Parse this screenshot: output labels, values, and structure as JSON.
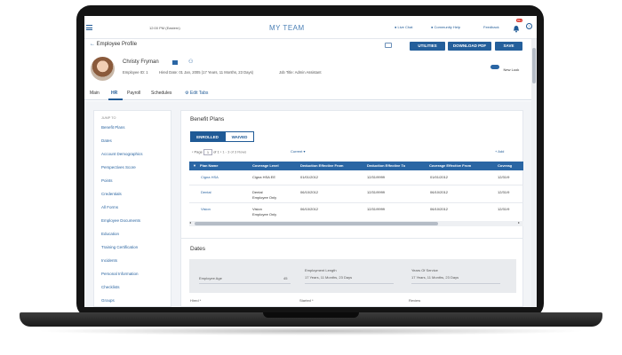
{
  "header": {
    "app_title": "MY TEAM",
    "datetime": "12:00 PM (Eastern)",
    "live_chat": "Live Chat",
    "community_help": "Community Help",
    "feedback": "Feedback",
    "notif_count": "99+"
  },
  "profile": {
    "back_label": "Employee Profile",
    "name": "Christy Fryman",
    "employee_id": "Employee ID: 1",
    "hired": "Hired Date: 01 Jan, 2005 (17 Years, 11 Months, 23 Days)",
    "job_title": "Job Title: Admin Assistant",
    "buttons": {
      "utilities": "UTILITIES",
      "download_pdf": "DOWNLOAD PDF",
      "save": "SAVE"
    },
    "new_look": "New Look"
  },
  "tabs": [
    "Main",
    "HR",
    "Payroll",
    "Schedules"
  ],
  "edit_tabs": "Edit Tabs",
  "sidebar": {
    "header": "JUMP TO",
    "items": [
      "Benefit Plans",
      "Dates",
      "Account Demographics",
      "Perspectives Score",
      "Points",
      "Credentials",
      "All Forms",
      "Employee Documents",
      "Education",
      "Training Certification",
      "Incidents",
      "Personal Information",
      "Checklists",
      "Groups"
    ]
  },
  "benefits": {
    "title": "Benefit Plans",
    "toggle": [
      "ENROLLED",
      "WAIVED"
    ],
    "pager": {
      "page_label": "Page",
      "page": "1",
      "of": "of 1",
      "range": "1 - 3 of 3 Rows",
      "filter": "Current"
    },
    "add": "+ Add",
    "columns": [
      "Plan Name",
      "Coverage Level",
      "Deduction Effective From",
      "Deduction Effective To",
      "Coverage Effective From",
      "Coverag"
    ],
    "rows": [
      {
        "plan": "Cigna HSA",
        "level": [
          "Cigna HSA EE"
        ],
        "ded_from": "01/01/2012",
        "ded_to": "12/31/9999",
        "cov_from": "01/01/2012",
        "cov_to": "12/31/9"
      },
      {
        "plan": "Dental",
        "level": [
          "Dental",
          "Employee Only"
        ],
        "ded_from": "06/10/2012",
        "ded_to": "12/31/9999",
        "cov_from": "06/10/2012",
        "cov_to": "12/31/9"
      },
      {
        "plan": "Vision",
        "level": [
          "Vision",
          "Employee Only"
        ],
        "ded_from": "06/10/2012",
        "ded_to": "12/31/9999",
        "cov_from": "06/10/2012",
        "cov_to": "12/31/9"
      }
    ]
  },
  "dates": {
    "title": "Dates",
    "employee_age_label": "Employee Age",
    "employee_age": "45",
    "employment_length_label": "Employment Length",
    "employment_length": "17 Years, 11 Months, 23 Days",
    "years_service_label": "Years Of Service",
    "years_service": "17 Years, 11 Months, 23 Days",
    "hired_label": "Hired *",
    "started_label": "Started *",
    "review_label": "Review"
  },
  "colors": {
    "accent": "#245f9b",
    "header_blue": "#2a66a4",
    "link": "#2a64a0",
    "notif": "#d9342b"
  }
}
